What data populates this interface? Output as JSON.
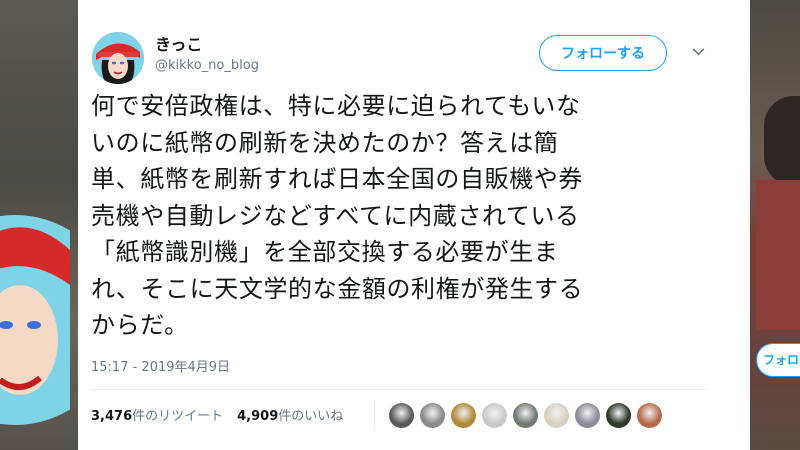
{
  "user": {
    "display_name": "きっこ",
    "handle": "@kikko_no_blog"
  },
  "follow_button_label": "フォローする",
  "background_follow_label": "フォローす",
  "tweet": {
    "lines": [
      "何で安倍政権は、特に必要に迫られてもいな",
      "いのに紙幣の刷新を決めたのか？答えは簡",
      "単、紙幣を刷新すれば日本全国の自販機や券",
      "売機や自動レジなどすべてに内蔵されている",
      "「紙幣識別機」を全部交換する必要が生ま",
      "れ、そこに天文学的な金額の利権が発生する",
      "からだ。"
    ],
    "timestamp": "15:17 - 2019年4月9日"
  },
  "stats": {
    "retweet_count": "3,476",
    "retweet_label": "件のリツイート",
    "like_count": "4,909",
    "like_label": "件のいいね"
  },
  "likers": [
    {
      "color": "#5a5a5a",
      "icon": "avatar-1"
    },
    {
      "color": "#8a8a8a",
      "icon": "avatar-2"
    },
    {
      "color": "#b08a3a",
      "icon": "avatar-3"
    },
    {
      "color": "#c9c9c9",
      "icon": "avatar-4"
    },
    {
      "color": "#6f7a70",
      "icon": "avatar-5"
    },
    {
      "color": "#d8d0c0",
      "icon": "avatar-6"
    },
    {
      "color": "#8c8c9c",
      "icon": "avatar-7"
    },
    {
      "color": "#2f3a2a",
      "icon": "avatar-8"
    },
    {
      "color": "#b46a4a",
      "icon": "avatar-9"
    }
  ],
  "colors": {
    "accent": "#1da1f2",
    "text": "#14171a",
    "secondary": "#657786"
  }
}
